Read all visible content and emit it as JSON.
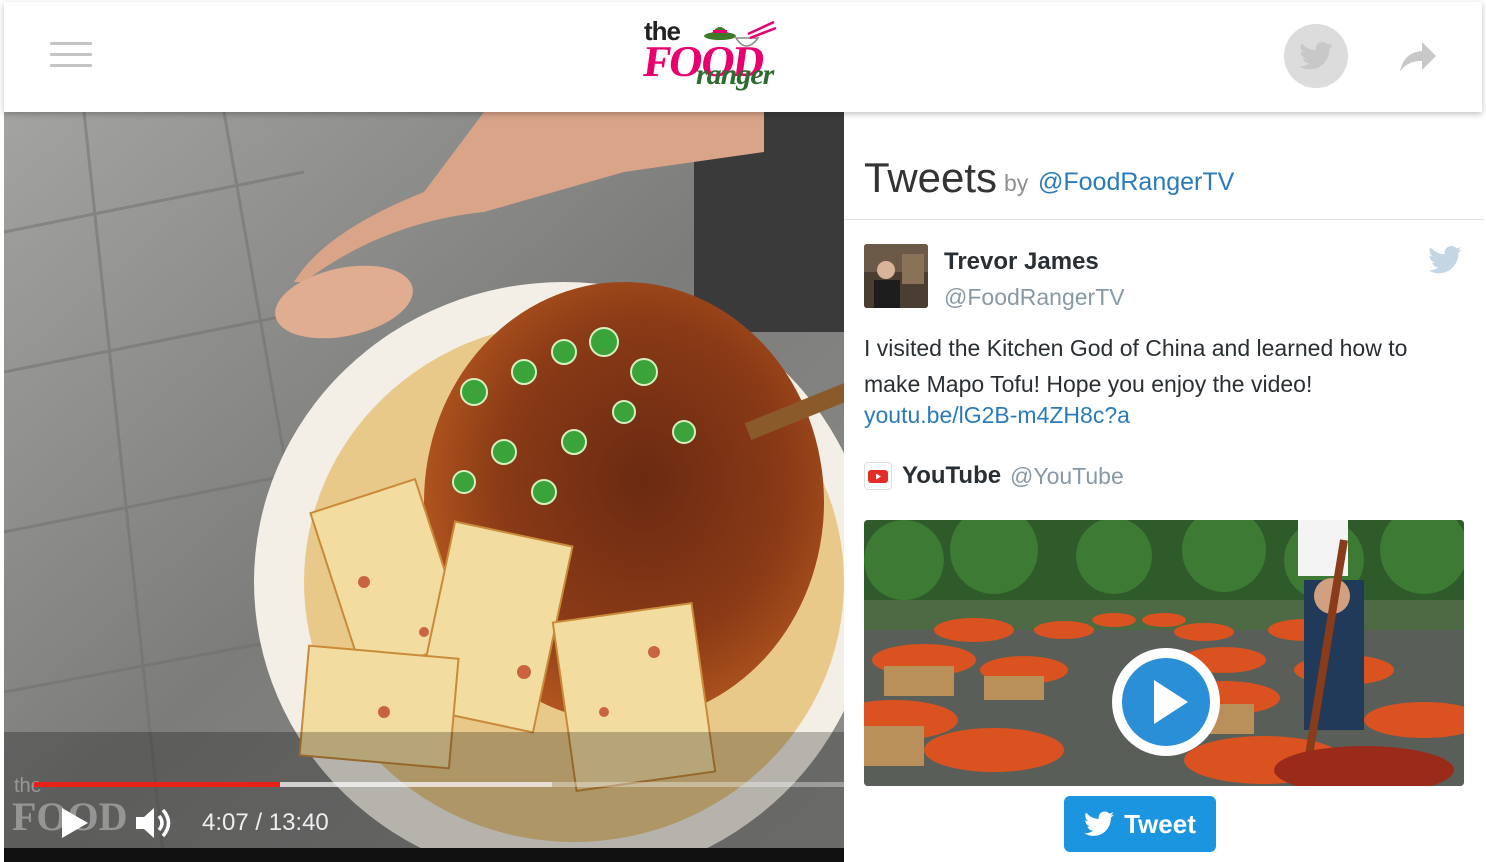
{
  "header": {
    "logo": {
      "line1": "the",
      "line2": "FOOD",
      "line3": "ranger"
    },
    "icons": {
      "menu": "hamburger-menu-icon",
      "twitter": "twitter-bird-icon",
      "share": "share-arrow-icon"
    }
  },
  "video": {
    "current_time": "4:07",
    "duration": "13:40",
    "time_display": "4:07 / 13:40",
    "played_fraction": 0.304,
    "buffered_fraction": 0.64,
    "progress_color": "#e62117",
    "icons": {
      "play": "play-icon",
      "volume": "volume-icon"
    }
  },
  "tweets_panel": {
    "title": "Tweets",
    "by": "by",
    "handle": "@FoodRangerTV",
    "tweet": {
      "author_name": "Trevor James",
      "author_handle": "@FoodRangerTV",
      "text": "I visited the Kitchen God of China and learned how to make Mapo Tofu! Hope you enjoy the video!",
      "link": "youtu.be/lG2B-m4ZH8c?a",
      "card": {
        "source_name": "YouTube",
        "source_handle": "@YouTube"
      }
    },
    "tweet_button": "Tweet",
    "link_color": "#2b7bb9",
    "button_color": "#1b95e0"
  }
}
